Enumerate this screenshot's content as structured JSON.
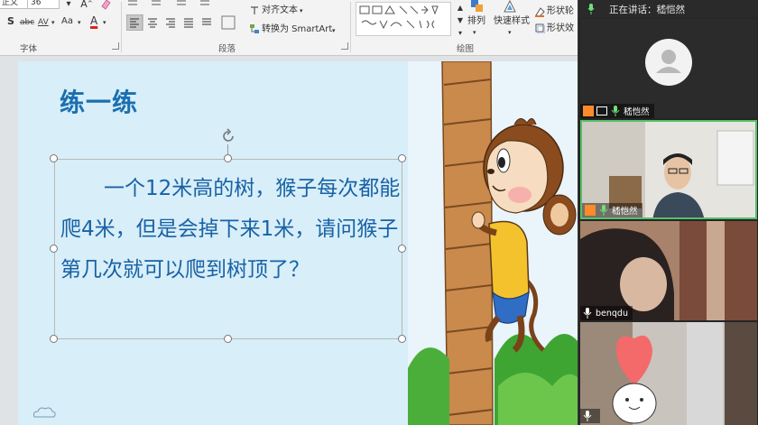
{
  "ribbon": {
    "font_name": "正文",
    "font_size": "36",
    "format_buttons": [
      "S",
      "abc",
      "AV",
      "Aa",
      "A"
    ],
    "font_group": "字体",
    "paragraph_group": "段落",
    "align_text": "对齐文本",
    "convert_smartart": "转换为 SmartArt",
    "drawing_group": "绘图",
    "arrange": "排列",
    "quick_styles": "快速样式",
    "shape_fill": "形状轮",
    "shape_effects": "形状效"
  },
  "slide": {
    "title": "练一练",
    "body": "一个12米高的树，猴子每次都能爬4米，但是会掉下来1米，请问猴子第几次就可以爬到树顶了？"
  },
  "video": {
    "speaking": "正在讲话：嵇恺然",
    "participants": [
      {
        "name": "嵇恺然"
      },
      {
        "name": "嵇恺然"
      },
      {
        "name": "benqdu"
      },
      {
        "name": ""
      }
    ]
  },
  "colors": {
    "title": "#1a6fb0",
    "body": "#1862a6",
    "slide_bg": "#d8eef8",
    "accent_orange": "#ff8a2a"
  }
}
